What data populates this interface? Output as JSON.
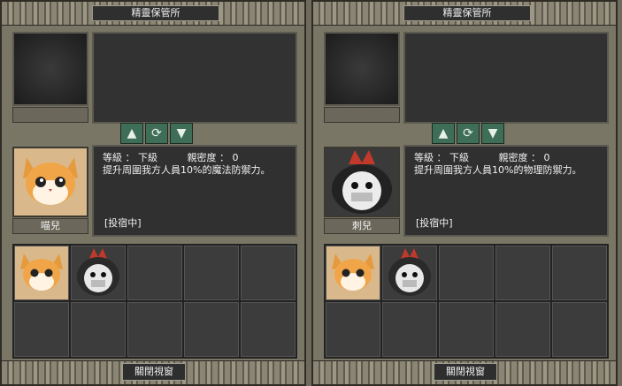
{
  "colors": {
    "button_green": "#3f6e58",
    "panel_bg": "#7a7666",
    "box_dark": "#303030"
  },
  "panels": [
    {
      "title": "精靈保管所",
      "pet_name": "喵兒",
      "level_label": "等級 ： 下級",
      "affinity_label": "親密度 ： 0",
      "description": "提升周圍我方人員10%的魔法防禦力。",
      "status": "[投宿中]",
      "close_label": "關閉視窗",
      "portrait_icon": "cat-pet-icon"
    },
    {
      "title": "精靈保管所",
      "pet_name": "刺兒",
      "level_label": "等級 ： 下級",
      "affinity_label": "親密度 ： 0",
      "description": "提升周圍我方人員10%的物理防禦力。",
      "status": "[投宿中]",
      "close_label": "關閉視窗",
      "portrait_icon": "hedgehog-pet-icon"
    }
  ],
  "buttons": {
    "up_icon": "arrow-up-icon",
    "swap_icon": "refresh-icon",
    "down_icon": "arrow-down-icon"
  },
  "storage_slots": [
    "cat-pet-icon",
    "hedgehog-pet-icon",
    "",
    "",
    "",
    "",
    "",
    "",
    "",
    ""
  ]
}
